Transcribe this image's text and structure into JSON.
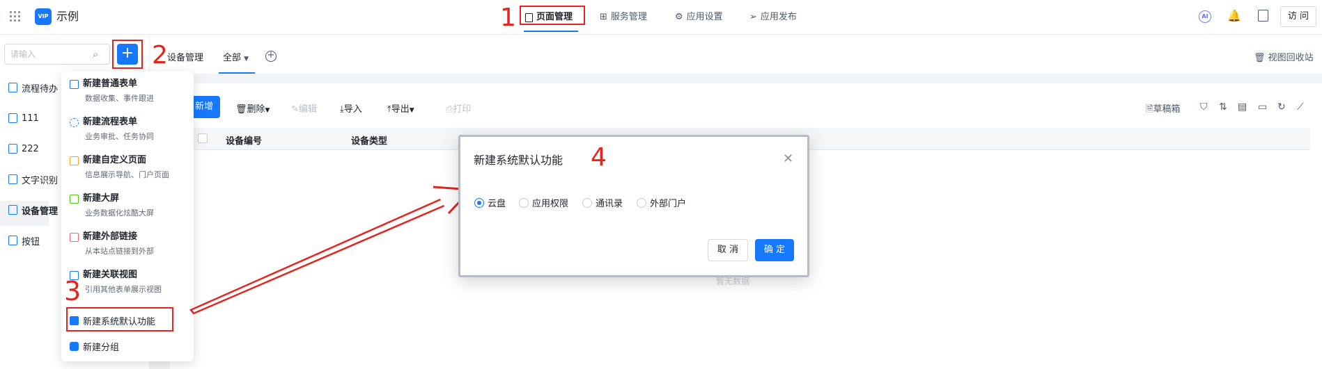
{
  "app": {
    "name": "示例",
    "logo_text": "VIP"
  },
  "topnav": {
    "items": [
      {
        "label": "页面管理",
        "icon": "page-icon",
        "active": true
      },
      {
        "label": "服务管理",
        "icon": "grid-icon"
      },
      {
        "label": "应用设置",
        "icon": "gear-icon"
      },
      {
        "label": "应用发布",
        "icon": "send-icon"
      }
    ],
    "visit_label": "访 问",
    "ai_label": "AI"
  },
  "sidebar": {
    "search_placeholder": "请输入",
    "add_label": "+",
    "items": [
      {
        "label": "流程待办"
      },
      {
        "label": "111"
      },
      {
        "label": "222"
      },
      {
        "label": "文字识别"
      },
      {
        "label": "设备管理",
        "selected": true
      },
      {
        "label": "按钮"
      }
    ]
  },
  "content": {
    "breadcrumb": "设备管理",
    "tab_all": "全部",
    "recycle_label": "视图回收站",
    "toolbar": {
      "add": "新增",
      "delete": "删除",
      "edit": "编辑",
      "import": "导入",
      "export": "导出",
      "print": "打印",
      "drafts": "草稿箱"
    },
    "table": {
      "columns": [
        "设备编号",
        "设备类型"
      ]
    },
    "empty_text": "暂无数据"
  },
  "dropdown": {
    "items": [
      {
        "title": "新建普通表单",
        "desc": "数据收集、事件跟进",
        "color": "#1677ff"
      },
      {
        "title": "新建流程表单",
        "desc": "业务审批、任务协同",
        "color": "#3b82f6"
      },
      {
        "title": "新建自定义页面",
        "desc": "信息展示导航、门户页面",
        "color": "#f5a623"
      },
      {
        "title": "新建大屏",
        "desc": "业务数据化炫酷大屏",
        "color": "#52c41a"
      },
      {
        "title": "新建外部链接",
        "desc": "从本站点链接到外部",
        "color": "#f56c6c"
      },
      {
        "title": "新建关联视图",
        "desc": "引用其他表单展示视图",
        "color": "#1677ff"
      }
    ],
    "system_default": "新建系统默认功能",
    "group": "新建分组"
  },
  "dialog": {
    "title": "新建系统默认功能",
    "options": [
      "云盘",
      "应用权限",
      "通讯录",
      "外部门户"
    ],
    "selected": "云盘",
    "cancel": "取 消",
    "confirm": "确 定"
  },
  "annotations": [
    "1",
    "2",
    "3",
    "4"
  ],
  "colors": {
    "primary": "#1677ff",
    "annotation": "#e52420"
  }
}
